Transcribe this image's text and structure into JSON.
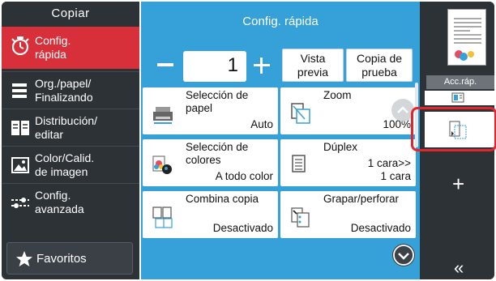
{
  "sidebar": {
    "title": "Copiar",
    "items": [
      {
        "label_1": "Config.",
        "label_2": "rápida",
        "icon": "quick-setup-icon",
        "active": true
      },
      {
        "label_1": "Org./papel/",
        "label_2": "Finalizando",
        "icon": "paper-finishing-icon",
        "active": false
      },
      {
        "label_1": "Distribución/",
        "label_2": "editar",
        "icon": "layout-edit-icon",
        "active": false
      },
      {
        "label_1": "Color/Calid.",
        "label_2": "de imagen",
        "icon": "color-quality-icon",
        "active": false
      },
      {
        "label_1": "Config.",
        "label_2": "avanzada",
        "icon": "advanced-setup-icon",
        "active": false
      }
    ],
    "favorites": "Favoritos"
  },
  "main": {
    "title": "Config. rápida",
    "copies": "1",
    "preview_1": "Vista",
    "preview_2": "previa",
    "proof_1": "Copia de",
    "proof_2": "prueba",
    "tiles": [
      {
        "title_1": "Selección de",
        "title_2": "papel",
        "value_1": "",
        "value_2": "Auto",
        "icon": "paper-selection-icon"
      },
      {
        "title_1": "Zoom",
        "title_2": "",
        "value_1": "",
        "value_2": "100%",
        "icon": "zoom-icon"
      },
      {
        "title_1": "Selección de",
        "title_2": "colores",
        "value_1": "",
        "value_2": "A todo color",
        "icon": "color-selection-icon"
      },
      {
        "title_1": "Dúplex",
        "title_2": "",
        "value_1": "1 cara>>",
        "value_2": "1 cara",
        "icon": "duplex-icon"
      },
      {
        "title_1": "Combina copia",
        "title_2": "",
        "value_1": "",
        "value_2": "Desactivado",
        "icon": "combine-icon"
      },
      {
        "title_1": "Grapar/perforar",
        "title_2": "",
        "value_1": "",
        "value_2": "Desactivado",
        "icon": "staple-punch-icon"
      }
    ]
  },
  "right": {
    "acc_tab": "Acc.ráp.",
    "add": "+",
    "collapse": "«"
  },
  "colors": {
    "accent": "#36a1d8",
    "sidebar": "#2d3237",
    "active": "#d7303a",
    "highlight": "#e0262f"
  }
}
